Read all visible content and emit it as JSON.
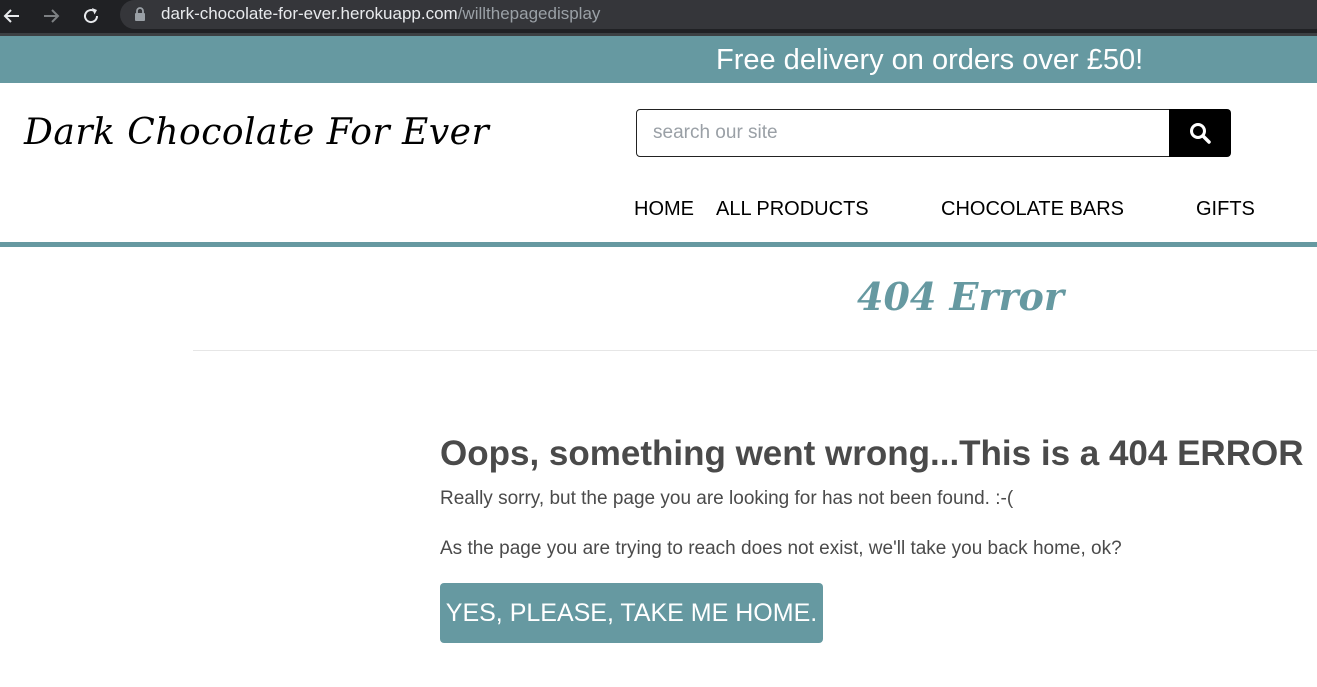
{
  "browser": {
    "url_host": "dark-chocolate-for-ever.herokuapp.com",
    "url_path": "/willthepagedisplay",
    "back_icon": "arrow-left-icon",
    "forward_icon": "arrow-right-icon",
    "reload_icon": "reload-icon",
    "lock_icon": "lock-icon"
  },
  "banner": {
    "text": "Free delivery on orders over £50!"
  },
  "header": {
    "logo": "Dark Chocolate For Ever",
    "search_placeholder": "search our site",
    "search_icon": "search-icon"
  },
  "nav": {
    "items": [
      {
        "label": "HOME"
      },
      {
        "label": "ALL PRODUCTS"
      },
      {
        "label": "CHOCOLATE BARS"
      },
      {
        "label": "GIFTS"
      }
    ]
  },
  "main": {
    "error_title": "404 Error",
    "headline": "Oops, something went wrong...This is a 404 ERROR",
    "paragraph_1": "Really sorry, but the page you are looking for has not been found. :-(",
    "paragraph_2": "As the page you are trying to reach does not exist, we'll take you back home, ok?",
    "home_button": "YES, PLEASE, TAKE ME HOME."
  },
  "colors": {
    "accent": "#6699a1",
    "chrome_bg": "#202124",
    "text": "#4a4a4a"
  }
}
